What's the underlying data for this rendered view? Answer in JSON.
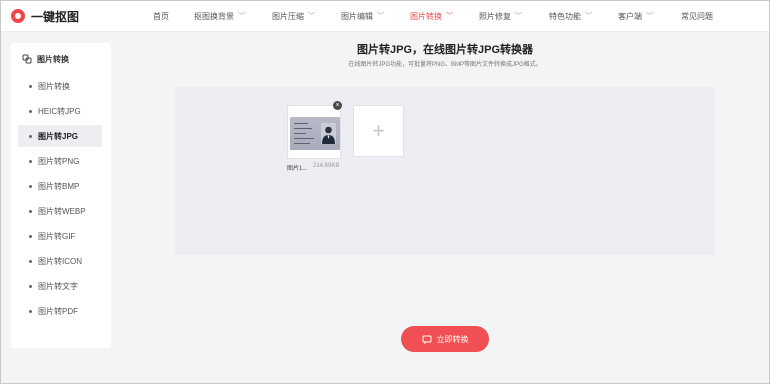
{
  "brand": {
    "name": "一键抠图",
    "accent": "#f04848"
  },
  "nav": {
    "items": [
      {
        "label": "首页",
        "has_menu": false,
        "active": false
      },
      {
        "label": "抠图换背景",
        "has_menu": true,
        "active": false
      },
      {
        "label": "图片压缩",
        "has_menu": true,
        "active": false
      },
      {
        "label": "图片编辑",
        "has_menu": true,
        "active": false
      },
      {
        "label": "图片转换",
        "has_menu": true,
        "active": true
      },
      {
        "label": "照片修复",
        "has_menu": true,
        "active": false
      },
      {
        "label": "特色功能",
        "has_menu": true,
        "active": false
      },
      {
        "label": "客户端",
        "has_menu": true,
        "active": false
      },
      {
        "label": "常见问题",
        "has_menu": false,
        "active": false
      }
    ]
  },
  "sidebar": {
    "title": "图片转换",
    "title_icon": "link-icon",
    "items": [
      {
        "label": "图片转换",
        "active": false
      },
      {
        "label": "HEIC转JPG",
        "active": false
      },
      {
        "label": "图片转JPG",
        "active": true
      },
      {
        "label": "图片转PNG",
        "active": false
      },
      {
        "label": "图片转BMP",
        "active": false
      },
      {
        "label": "图片转WEBP",
        "active": false
      },
      {
        "label": "图片转GIF",
        "active": false
      },
      {
        "label": "图片转ICON",
        "active": false
      },
      {
        "label": "图片转文字",
        "active": false
      },
      {
        "label": "图片转PDF",
        "active": false
      }
    ]
  },
  "main": {
    "title": "图片转JPG，在线图片转JPG转换器",
    "subtitle": "在线图片转JPG功能，可批量将PNG、BMP等图片文件转换成JPG格式。",
    "file": {
      "name": "图片1...",
      "size": "214.69KB"
    },
    "add_icon": "plus-icon",
    "close_icon": "close-icon",
    "convert_label": "立即转换",
    "convert_icon": "convert-icon",
    "button_color": "#f05053"
  }
}
